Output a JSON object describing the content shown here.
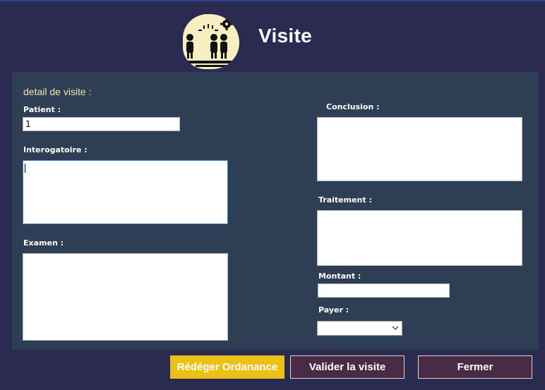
{
  "header": {
    "title": "Visite"
  },
  "form": {
    "section_title": "detail de visite :",
    "patient_label": "Patient :",
    "patient_value": "1",
    "interogatoire_label": "Interogatoire :",
    "interogatoire_value": "",
    "examen_label": "Examen :",
    "examen_value": "",
    "conclusion_label": "Conclusion :",
    "conclusion_value": "",
    "traitement_label": "Traitement :",
    "traitement_value": "",
    "montant_label": "Montant :",
    "montant_value": "",
    "payer_label": "Payer :",
    "payer_value": ""
  },
  "actions": {
    "rediger_label": "Rédéger Ordanance",
    "valider_label": "Valider la visite",
    "fermer_label": "Fermer"
  },
  "icons": {
    "logo": "group-people-icon",
    "dropdown": "chevron-down-icon"
  },
  "colors": {
    "background": "#2b2a50",
    "panel": "#2e3e55",
    "accent_yellow": "#ebc118",
    "button_dark": "#4a2b45",
    "section_title": "#f2e7b0"
  }
}
